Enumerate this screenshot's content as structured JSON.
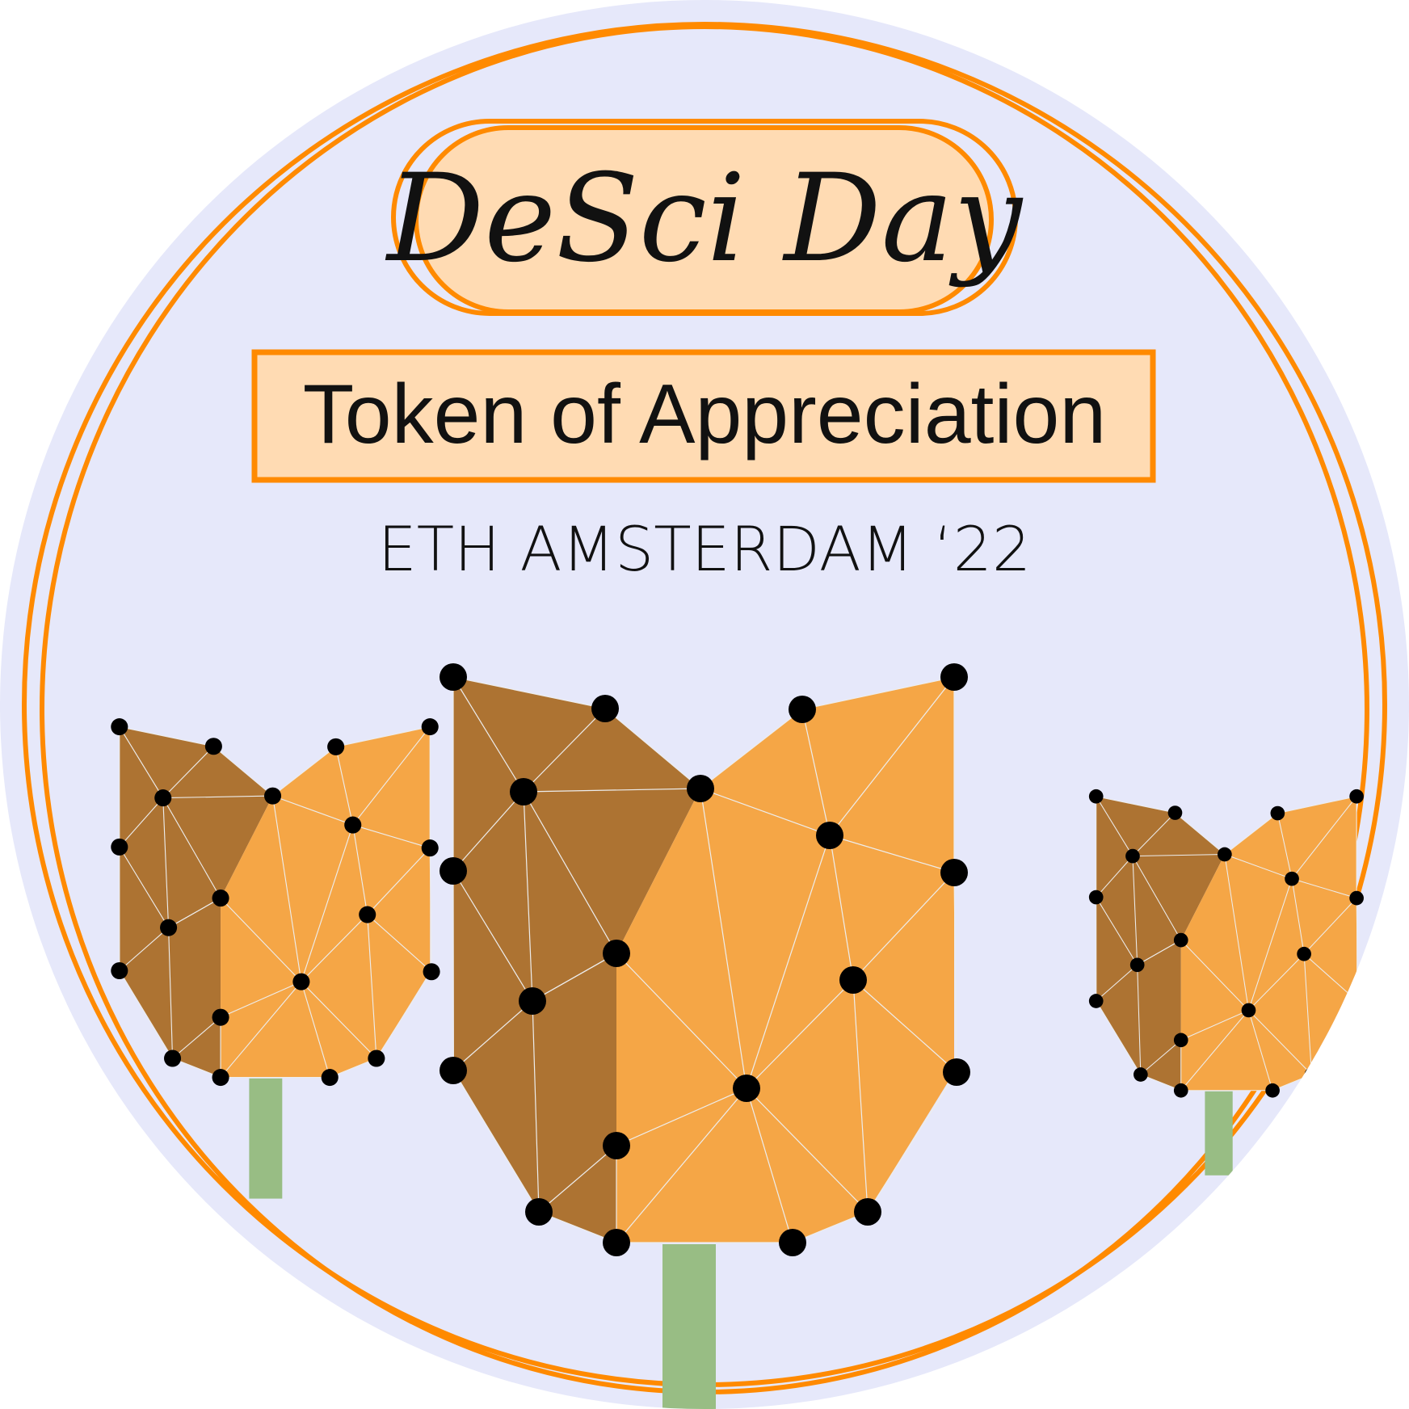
{
  "badge": {
    "title": "DeSci Day",
    "label": "Token of Appreciation",
    "subtitle": "ETH AMSTERDAM ‘22"
  },
  "colors": {
    "background": "#E6E8FA",
    "ring": "#FF8A00",
    "pill_fill": "#FFDBB3",
    "petal_light": "#F5A646",
    "petal_dark": "#AD7332",
    "stem": "#98BD84",
    "node": "#000000",
    "edge": "#EDEDED"
  },
  "illustration": {
    "icon_names": [
      "tulip-left-icon",
      "tulip-center-icon",
      "tulip-right-icon"
    ]
  }
}
